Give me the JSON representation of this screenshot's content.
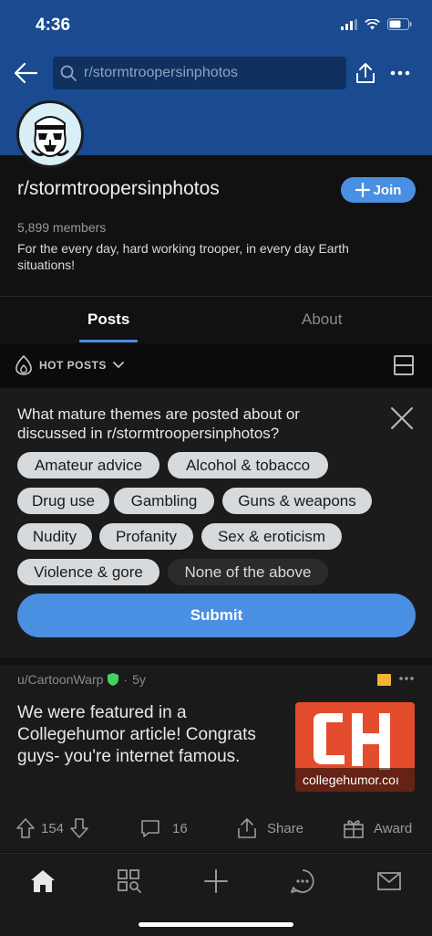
{
  "status_bar": {
    "time": "4:36"
  },
  "search": {
    "query": "r/stormtroopersinphotos"
  },
  "subreddit": {
    "name": "r/stormtroopersinphotos",
    "join_label": "Join",
    "members": "5,899 members",
    "description": "For the every day, hard working trooper, in every day Earth situations!"
  },
  "tabs": [
    {
      "label": "Posts",
      "active": true
    },
    {
      "label": "About",
      "active": false
    }
  ],
  "sort": {
    "label": "HOT POSTS"
  },
  "survey": {
    "question": "What mature themes are posted about or discussed in r/stormtroopersinphotos?",
    "options": [
      "Amateur advice",
      "Alcohol & tobacco",
      "Drug use",
      "Gambling",
      "Guns & weapons",
      "Nudity",
      "Profanity",
      "Sex & eroticism",
      "Violence & gore",
      "None of the above"
    ],
    "submit_label": "Submit"
  },
  "post": {
    "author": "u/CartoonWarp",
    "age": "5y",
    "title": "We were featured in a Collegehumor article! Congrats guys- you're internet famous.",
    "thumbnail_caption": "collegehumor.coı",
    "votes": "154",
    "comments": "16",
    "share_label": "Share",
    "award_label": "Award"
  },
  "colors": {
    "header": "#1a4a8f",
    "accent": "#4a90e2",
    "thumbnail": "#e34c2d",
    "mod_badge": "#f2b233"
  }
}
